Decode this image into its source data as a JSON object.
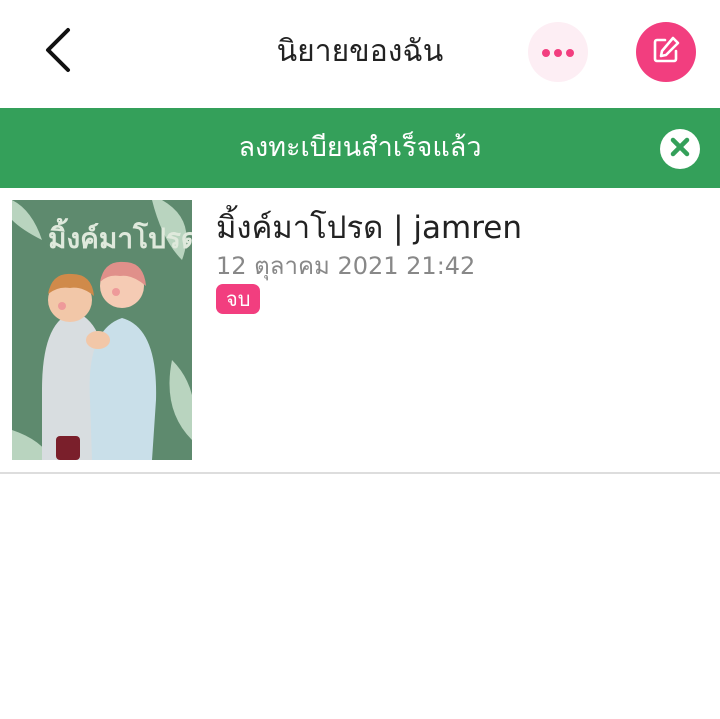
{
  "header": {
    "title": "นิยายของฉัน"
  },
  "banner": {
    "message": "ลงทะเบียนสำเร็จแล้ว"
  },
  "novels": [
    {
      "title": "มิ้งค์มาโปรด | jamren",
      "date": "12 ตุลาคม 2021 21:42",
      "status": "จบ",
      "cover_title": "มิ้งค์มาโปรด"
    }
  ],
  "icons": {
    "back": "chevron-left-icon",
    "more": "more-dots-icon",
    "edit": "edit-icon",
    "close": "close-icon"
  },
  "colors": {
    "accent": "#f23e7f",
    "accent_light": "#fdeef4",
    "success": "#34a05a",
    "text_primary": "#222222",
    "text_secondary": "#888888",
    "cover_bg": "#5e8a6e"
  }
}
